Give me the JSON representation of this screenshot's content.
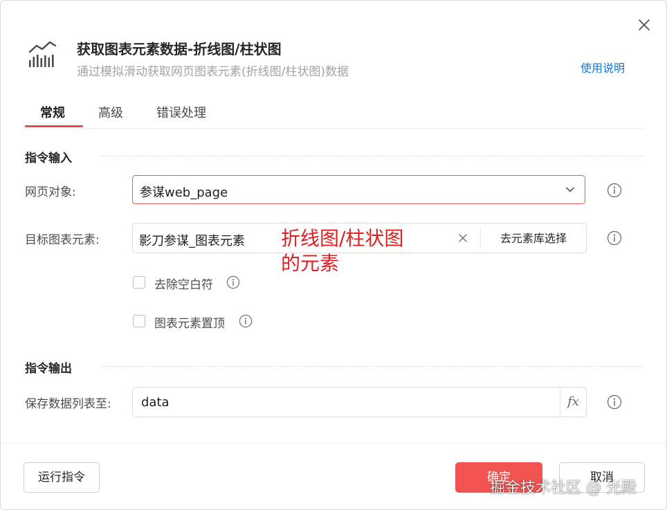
{
  "dialog": {
    "title": "获取图表元素数据-折线图/柱状图",
    "subtitle": "通过模拟滑动获取网页图表元素(折线图/柱状图)数据",
    "help_link": "使用说明",
    "icon": "line-bar-chart-icon"
  },
  "tabs": [
    {
      "label": "常规",
      "active": true
    },
    {
      "label": "高级",
      "active": false
    },
    {
      "label": "错误处理",
      "active": false
    }
  ],
  "input_section": {
    "title": "指令输入",
    "web_page": {
      "label": "网页对象:",
      "value": "参谋web_page"
    },
    "target_element": {
      "label": "目标图表元素:",
      "value": "影刀参谋_图表元素",
      "library_button": "去元素库选择"
    },
    "options": [
      {
        "label": "去除空白符",
        "checked": false
      },
      {
        "label": "图表元素置顶",
        "checked": false
      }
    ]
  },
  "annotation": {
    "line1": "折线图/柱状图",
    "line2": "的元素",
    "color": "#e02020"
  },
  "output_section": {
    "title": "指令输出",
    "save_to": {
      "label": "保存数据列表至:",
      "value": "data",
      "fx_label": "fx"
    }
  },
  "footer": {
    "run_button": "运行指令",
    "ok_button": "确定",
    "cancel_button": "取消"
  },
  "watermark": "掘金技术社区 @ 光殿",
  "colors": {
    "accent": "#f25353",
    "tab_underline": "#e64a4a",
    "link": "#1677d6"
  }
}
